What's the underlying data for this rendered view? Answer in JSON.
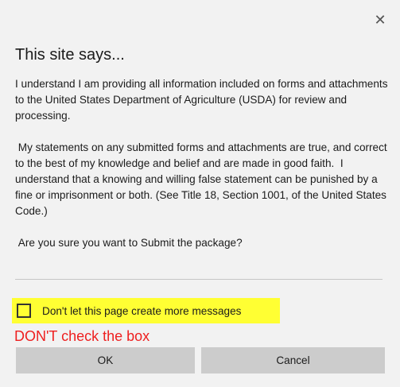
{
  "dialog": {
    "close_glyph": "✕",
    "title": "This site says...",
    "paragraphs": [
      "I understand I am providing all information included on forms and attachments to the United States Department of Agriculture (USDA) for review and processing.",
      " My statements on any submitted forms and attachments are true, and correct to the best of my knowledge and belief and are made in good faith.  I understand that a knowing and willing false statement can be punished by a fine or imprisonment or both. (See Title 18, Section 1001, of the United States Code.)",
      " Are you sure you want to Submit the package?"
    ],
    "checkbox": {
      "label": "Don't let this page create more messages",
      "checked": false,
      "highlight_color": "#ffff33"
    },
    "annotation": {
      "text": "DON'T check the box",
      "color": "#ee2020"
    },
    "buttons": {
      "ok_label": "OK",
      "cancel_label": "Cancel"
    }
  }
}
